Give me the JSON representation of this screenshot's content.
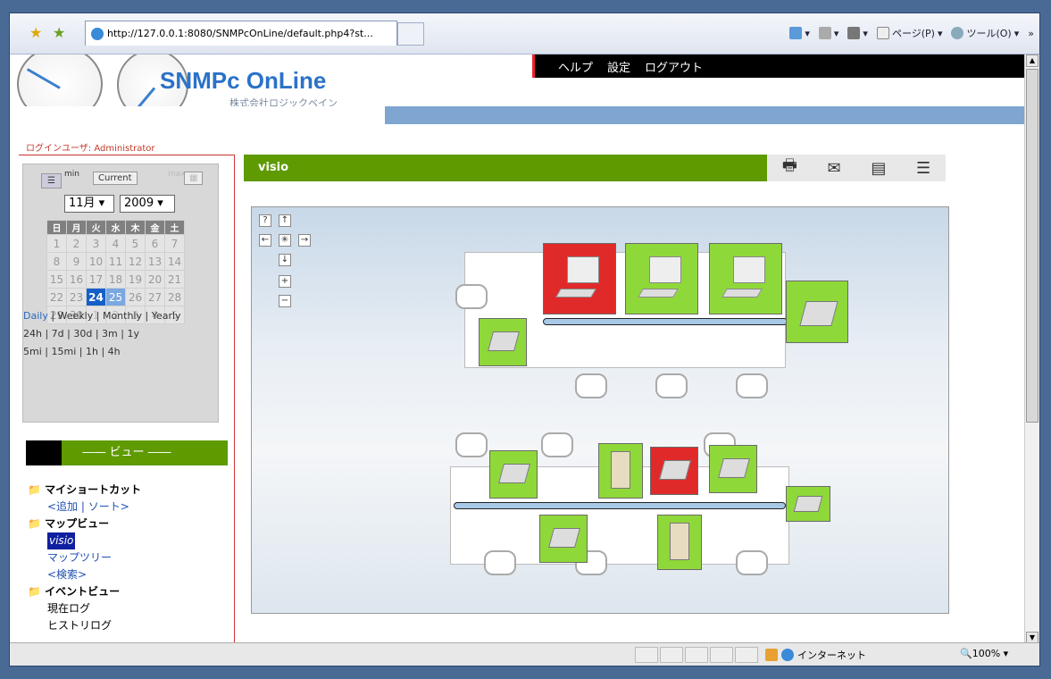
{
  "browser": {
    "tab_title": "http://127.0.0.1:8080/SNMPcOnLine/default.php4?st...",
    "tools": {
      "page": "ページ(P)",
      "tool": "ツール(O)",
      "more": "»"
    },
    "status": {
      "zone": "インターネット",
      "zoom": "100%"
    }
  },
  "header": {
    "logo": "SNMPc OnLine",
    "company": "株式会社ロジックベイン",
    "nav": [
      "ヘルプ",
      "設定",
      "ログアウト"
    ]
  },
  "login_user": "ログインユーザ: Administrator",
  "calendar": {
    "min_label": "min",
    "current_label": "Current",
    "max_label": "max",
    "month": "11月",
    "year": "2009",
    "weekdays": [
      "日",
      "月",
      "火",
      "水",
      "木",
      "金",
      "土"
    ],
    "weeks": [
      [
        "1",
        "2",
        "3",
        "4",
        "5",
        "6",
        "7"
      ],
      [
        "8",
        "9",
        "10",
        "11",
        "12",
        "13",
        "14"
      ],
      [
        "15",
        "16",
        "17",
        "18",
        "19",
        "20",
        "21"
      ],
      [
        "22",
        "23",
        "24",
        "25",
        "26",
        "27",
        "28"
      ],
      [
        "29",
        "30",
        "1",
        "2",
        "3",
        "4",
        "5"
      ]
    ],
    "period_line1": [
      "Daily",
      "Weekly",
      "Monthly",
      "Yearly"
    ],
    "period_line2": [
      "24h",
      "7d",
      "30d",
      "3m",
      "1y"
    ],
    "period_line3": [
      "5mi",
      "15mi",
      "1h",
      "4h"
    ]
  },
  "view_panel": {
    "title": "ビュー",
    "shortcut": "マイショートカット",
    "shortcut_actions": "<追加 | ソート>",
    "mapview": "マップビュー",
    "visio": "visio",
    "maptree": "マップツリー",
    "search": "<検索>",
    "eventview": "イベントビュー",
    "current_log": "現在ログ",
    "history_log": "ヒストリログ"
  },
  "visio": {
    "title": "visio"
  },
  "colors": {
    "accent_green": "#5e9a00",
    "ok_green": "#8fd83a",
    "alarm_red": "#e02a2a",
    "logo_blue": "#2a72c8"
  }
}
